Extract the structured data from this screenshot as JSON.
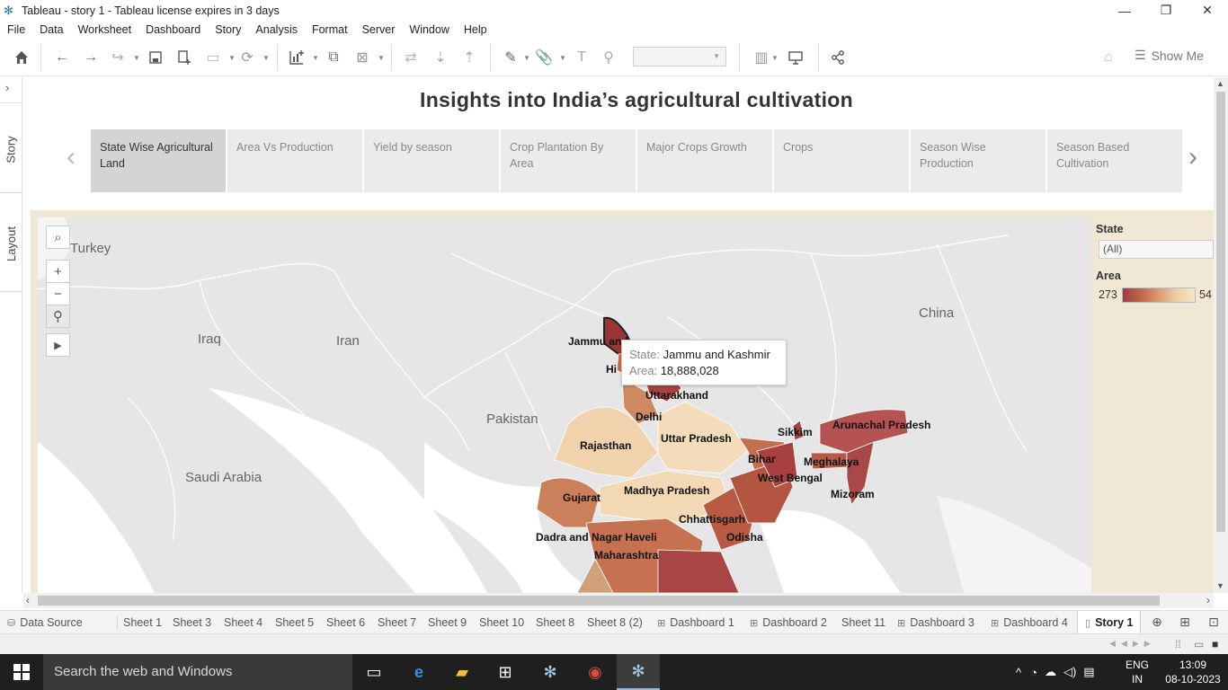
{
  "window": {
    "title": "Tableau - story 1 - Tableau license expires in 3 days",
    "minimize": "—",
    "restore": "❐",
    "close": "✕"
  },
  "menu": [
    "File",
    "Data",
    "Worksheet",
    "Dashboard",
    "Story",
    "Analysis",
    "Format",
    "Server",
    "Window",
    "Help"
  ],
  "toolbar": {
    "show_me_label": "Show Me"
  },
  "side_panel": {
    "story_tab": "Story",
    "layout_tab": "Layout"
  },
  "story": {
    "title": "Insights into India’s agricultural cultivation",
    "points": [
      {
        "label": "State Wise Agricultural Land"
      },
      {
        "label": "Area Vs Production"
      },
      {
        "label": "Yield by season"
      },
      {
        "label": "Crop Plantation By Area"
      },
      {
        "label": "Major Crops Growth"
      },
      {
        "label": "Crops"
      },
      {
        "label": "Season Wise Production"
      },
      {
        "label": "Season  Based Cultivation"
      }
    ]
  },
  "map": {
    "countries": [
      "Turkey",
      "Iraq",
      "Iran",
      "Saudi Arabia",
      "Pakistan",
      "China"
    ],
    "states": [
      "Jammu and Kashmir",
      "Hi",
      "Uttarakhand",
      "Delhi",
      "Rajasthan",
      "Uttar Pradesh",
      "Bihar",
      "Sikkim",
      "Arunachal Pradesh",
      "Meghalaya",
      "West Bengal",
      "Mizoram",
      "Gujarat",
      "Madhya Pradesh",
      "Chhattisgarh",
      "Odisha",
      "Dadra and Nagar Haveli",
      "Maharashtra"
    ],
    "state_labels_visible": {
      "jk": "Jammu and",
      "hp": "Hi"
    },
    "tooltip": {
      "state_key": "State:",
      "state_value": "Jammu and Kashmir",
      "area_key": "Area:",
      "area_value": "18,888,028"
    }
  },
  "legend": {
    "state_title": "State",
    "state_filter_value": "(All)",
    "area_title": "Area",
    "area_min": "273",
    "area_max": "54",
    "colors": [
      "#a23c3c",
      "#c2654a",
      "#dc9a72",
      "#efcfa3",
      "#f7e6c8"
    ]
  },
  "sheet_tabs": [
    {
      "label": "Data Source",
      "icon": "database-icon"
    },
    {
      "label": "Sheet 1"
    },
    {
      "label": "Sheet 3"
    },
    {
      "label": "Sheet 4"
    },
    {
      "label": "Sheet 5"
    },
    {
      "label": "Sheet 6"
    },
    {
      "label": "Sheet 7"
    },
    {
      "label": "Sheet 9"
    },
    {
      "label": "Sheet 10"
    },
    {
      "label": "Sheet 8"
    },
    {
      "label": "Sheet 8 (2)"
    },
    {
      "label": "Dashboard 1",
      "icon": "dashboard-icon"
    },
    {
      "label": "Dashboard 2",
      "icon": "dashboard-icon"
    },
    {
      "label": "Sheet 11"
    },
    {
      "label": "Dashboard 3",
      "icon": "dashboard-icon"
    },
    {
      "label": "Dashboard 4",
      "icon": "dashboard-icon"
    },
    {
      "label": "Story 1",
      "icon": "story-icon",
      "active": true
    }
  ],
  "taskbar": {
    "search_placeholder": "Search the web and Windows",
    "lang_top": "ENG",
    "lang_bottom": "IN",
    "time": "13:09",
    "date": "08-10-2023"
  }
}
